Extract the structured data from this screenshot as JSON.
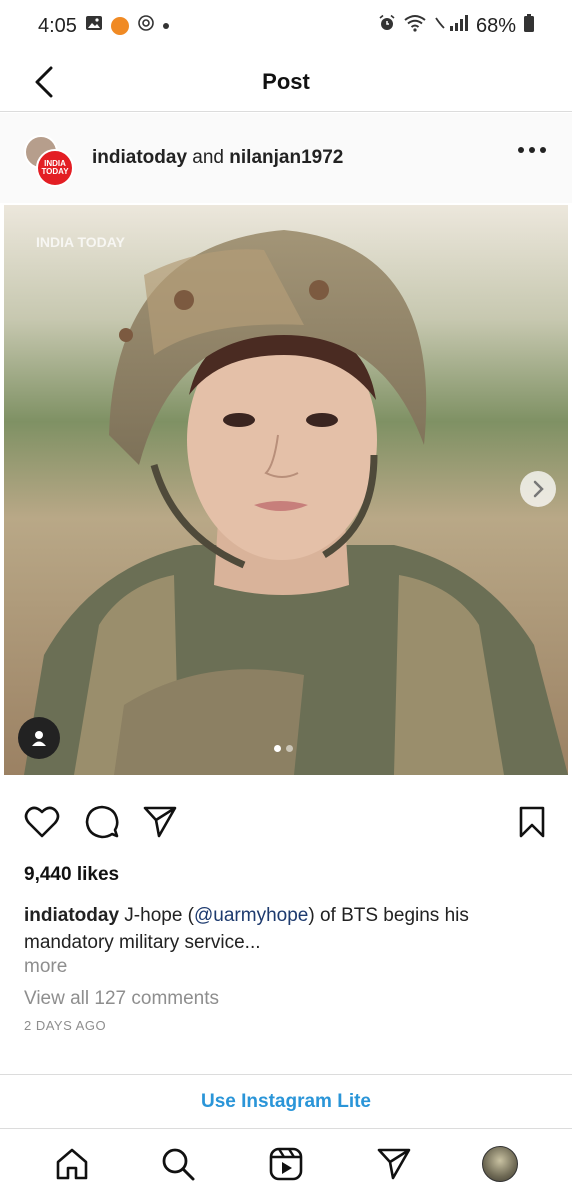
{
  "status_bar": {
    "time": "4:05",
    "battery": "68%"
  },
  "header": {
    "title": "Post"
  },
  "post": {
    "account": "indiatoday",
    "joiner": "and",
    "collaborator": "nilanjan1972",
    "avatar_text": "INDIA TODAY",
    "watermark": "INDIA TODAY",
    "likes": "9,440 likes",
    "caption_user": "indiatoday",
    "caption_before": "J-hope (",
    "caption_mention": "@uarmyhope",
    "caption_after": ") of BTS begins his mandatory military service...",
    "more": "more",
    "view_comments": "View all 127 comments",
    "timestamp": "2 DAYS AGO",
    "carousel_index": 1,
    "carousel_total": 2
  },
  "banner": {
    "label": "Use Instagram Lite"
  },
  "colors": {
    "accent_blue": "#2a95d8",
    "mention": "#1d3a6e",
    "muted": "#8e8e8e",
    "notification_dot": "#f08a24"
  },
  "icons": {
    "back": "chevron-left-icon",
    "more": "more-horizontal-icon",
    "like": "heart-icon",
    "comment": "comment-icon",
    "share": "send-icon",
    "save": "bookmark-icon",
    "tag": "user-tag-icon",
    "next": "chevron-right-icon",
    "nav": [
      "home-icon",
      "search-icon",
      "reels-icon",
      "send-icon",
      "profile-avatar"
    ]
  }
}
